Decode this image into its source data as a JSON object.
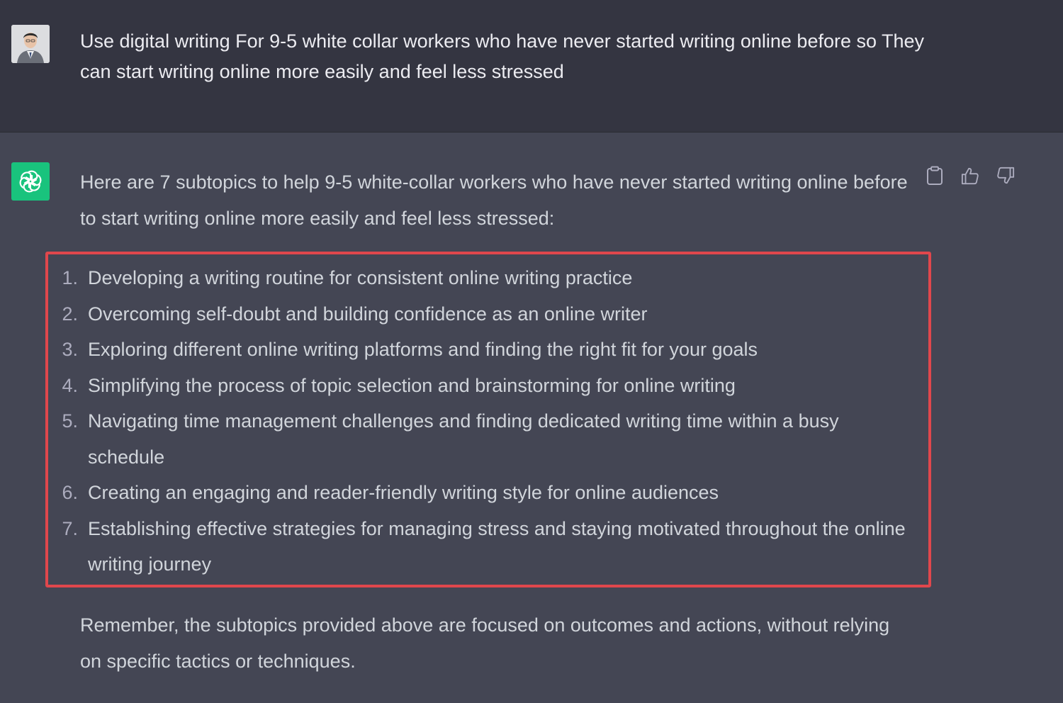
{
  "user_message": {
    "text": "Use digital writing For 9-5 white collar workers who have never started writing online before so They can start writing online more easily and feel less stressed"
  },
  "assistant_message": {
    "intro": "Here are 7 subtopics to help 9-5 white-collar workers who have never started writing online before to start writing online more easily and feel less stressed:",
    "items": [
      {
        "num": "1.",
        "text": "Developing a writing routine for consistent online writing practice"
      },
      {
        "num": "2.",
        "text": "Overcoming self-doubt and building confidence as an online writer"
      },
      {
        "num": "3.",
        "text": "Exploring different online writing platforms and finding the right fit for your goals"
      },
      {
        "num": "4.",
        "text": "Simplifying the process of topic selection and brainstorming for online writing"
      },
      {
        "num": "5.",
        "text": "Navigating time management challenges and finding dedicated writing time within a busy schedule"
      },
      {
        "num": "6.",
        "text": "Creating an engaging and reader-friendly writing style for online audiences"
      },
      {
        "num": "7.",
        "text": "Establishing effective strategies for managing stress and staying motivated throughout the online writing journey"
      }
    ],
    "outro": "Remember, the subtopics provided above are focused on outcomes and actions, without relying on specific tactics or techniques."
  },
  "icons": {
    "user_avatar": "user-avatar-photo",
    "bot_avatar": "openai-logo-icon",
    "copy": "clipboard-icon",
    "like": "thumbs-up-icon",
    "dislike": "thumbs-down-icon"
  },
  "colors": {
    "user_bg": "#343541",
    "assistant_bg": "#444654",
    "bot_avatar_bg": "#19c37d",
    "highlight_border": "#e0474c",
    "text": "#d1d5db"
  }
}
